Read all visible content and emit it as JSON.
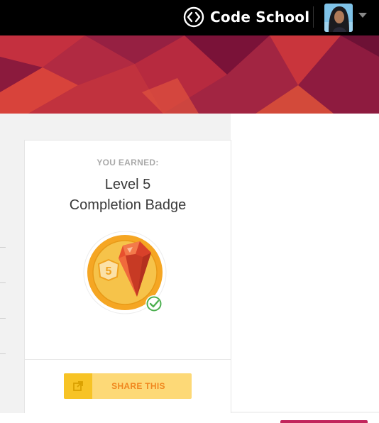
{
  "header": {
    "brand": "Code School",
    "logo_icon": "code-brackets-icon",
    "avatar_icon": "user-avatar",
    "menu_icon": "caret-down-icon"
  },
  "banner": {
    "colors": [
      "#8b1a3d",
      "#b7263a",
      "#d8433b",
      "#7a1238"
    ]
  },
  "badge_card": {
    "earned_label": "YOU EARNED:",
    "title_line1": "Level 5",
    "title_line2": "Completion Badge",
    "level_number": "5",
    "completed_icon": "check-circle-icon",
    "gem_icon": "ruby-gem-icon",
    "share_label": "SHARE THIS",
    "share_icon": "share-external-icon"
  },
  "colors": {
    "badge_gold": "#f5a623",
    "badge_inner": "#f6c34a",
    "gem": "#e8502e",
    "check_green": "#4caf50",
    "share_bg": "#fdd977",
    "share_icon_bg": "#f7c325",
    "share_text": "#f0871e",
    "footer_accent": "#c2255c"
  }
}
